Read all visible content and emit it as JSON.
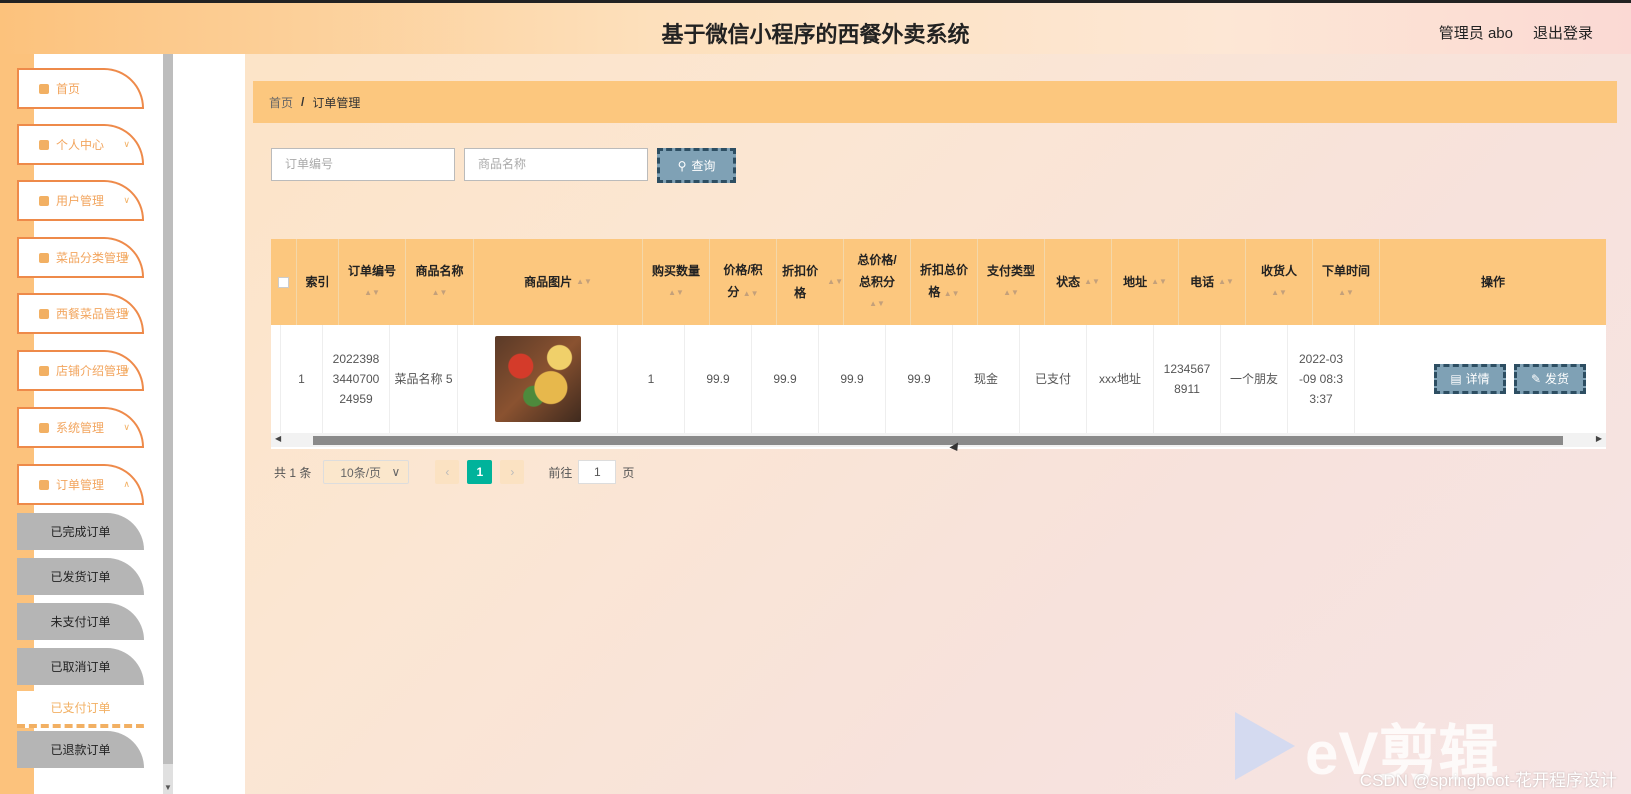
{
  "header": {
    "title": "基于微信小程序的西餐外卖系统",
    "user_label": "管理员 abo",
    "logout": "退出登录"
  },
  "sidebar": {
    "items": [
      {
        "label": "首页",
        "icon": "home-icon"
      },
      {
        "label": "个人中心",
        "icon": "user-icon"
      },
      {
        "label": "用户管理",
        "icon": "clipboard-icon"
      },
      {
        "label": "菜品分类管理",
        "icon": "grid-icon"
      },
      {
        "label": "西餐菜品管理",
        "icon": "clipboard-icon"
      },
      {
        "label": "店铺介绍管理",
        "icon": "grid-icon"
      },
      {
        "label": "系统管理",
        "icon": "grid-icon"
      },
      {
        "label": "订单管理",
        "icon": "user-icon"
      }
    ],
    "sub_items": [
      {
        "label": "已完成订单"
      },
      {
        "label": "已发货订单"
      },
      {
        "label": "未支付订单"
      },
      {
        "label": "已取消订单"
      },
      {
        "label": "已支付订单",
        "active": true
      },
      {
        "label": "已退款订单"
      }
    ]
  },
  "breadcrumb": {
    "home": "首页",
    "sep": "/",
    "current": "订单管理"
  },
  "search": {
    "order_no_placeholder": "订单编号",
    "goods_name_placeholder": "商品名称",
    "query_label": "查询"
  },
  "table": {
    "headers": [
      {
        "l1": "索引",
        "l2": ""
      },
      {
        "l1": "订单编号",
        "l2": ""
      },
      {
        "l1": "商品名称",
        "l2": ""
      },
      {
        "l1": "商品图片",
        "l2": ""
      },
      {
        "l1": "购买数量",
        "l2": ""
      },
      {
        "l1": "价格/积",
        "l2": "分"
      },
      {
        "l1": "折扣价格",
        "l2": ""
      },
      {
        "l1": "总价格/",
        "l2": "总积分"
      },
      {
        "l1": "折扣总价",
        "l2": "格"
      },
      {
        "l1": "支付类型",
        "l2": ""
      },
      {
        "l1": "状态",
        "l2": ""
      },
      {
        "l1": "地址",
        "l2": ""
      },
      {
        "l1": "电话",
        "l2": ""
      },
      {
        "l1": "收货人",
        "l2": ""
      },
      {
        "l1": "下单时间",
        "l2": ""
      },
      {
        "l1": "操作",
        "l2": ""
      }
    ],
    "rows": [
      {
        "index": "1",
        "order_no": "2022398 3440700 24959",
        "goods_name": "菜品名称 5",
        "quantity": "1",
        "price": "99.9",
        "discount_price": "99.9",
        "total_price": "99.9",
        "discount_total": "99.9",
        "pay_type": "现金",
        "status": "已支付",
        "address": "xxx地址",
        "phone": "1234567 8911",
        "receiver": "一个朋友",
        "order_time": "2022-03 -09 08:3 3:37",
        "detail_label": "详情",
        "ship_label": "发货"
      }
    ]
  },
  "pagination": {
    "total": "共 1 条",
    "page_size": "10条/页",
    "current_page": "1",
    "goto_label": "前往",
    "goto_value": "1",
    "page_unit": "页"
  },
  "watermark": {
    "ev": "eV剪辑",
    "csdn": "CSDN @springboot-花开程序设计"
  },
  "colors": {
    "accent_orange": "#fcc77e",
    "menu_border": "#ee8a4a",
    "button_blue": "#7fa1b5",
    "active_page": "#00b39b"
  }
}
